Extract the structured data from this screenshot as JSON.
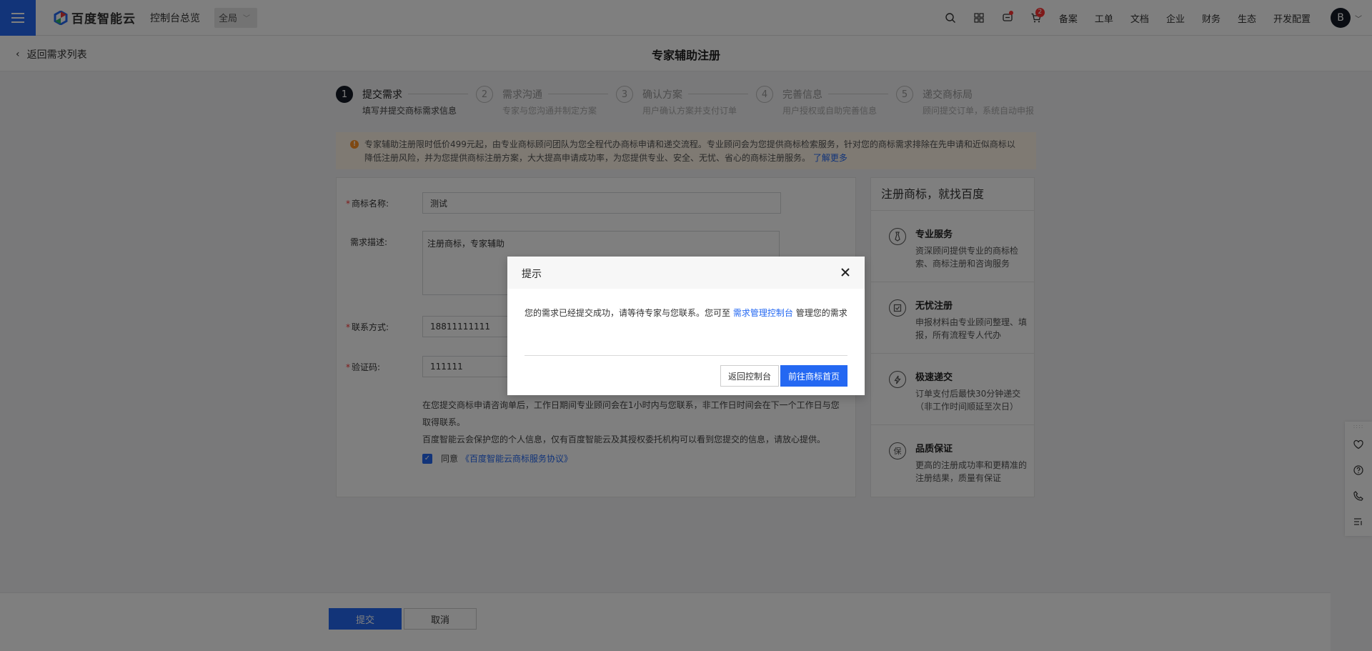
{
  "colors": {
    "brand": "#2468f2",
    "danger": "#ff3333",
    "warning": "#ff9326",
    "dark": "#151b26"
  },
  "topbar": {
    "logo_text": "百度智能云",
    "console_label": "控制台总览",
    "region_label": "全局",
    "cart_badge": "2",
    "nav_items": [
      "备案",
      "工单",
      "文档",
      "企业",
      "财务",
      "生态",
      "开发配置"
    ],
    "avatar_initial": "B",
    "icons": [
      "search-icon",
      "grid-icon",
      "message-icon",
      "cart-icon"
    ]
  },
  "subheader": {
    "back_label": "返回需求列表",
    "title": "专家辅助注册"
  },
  "steps": [
    {
      "num": "1",
      "title": "提交需求",
      "desc": "填写并提交商标需求信息",
      "active": true
    },
    {
      "num": "2",
      "title": "需求沟通",
      "desc": "专家与您沟通并制定方案",
      "active": false
    },
    {
      "num": "3",
      "title": "确认方案",
      "desc": "用户确认方案并支付订单",
      "active": false
    },
    {
      "num": "4",
      "title": "完善信息",
      "desc": "用户授权或自助完善信息",
      "active": false
    },
    {
      "num": "5",
      "title": "递交商标局",
      "desc": "顾问提交订单，系统自动申报",
      "active": false
    }
  ],
  "notice": {
    "line1": "专家辅助注册限时低价499元起，由专业商标顾问团队为您全程代办商标申请和递交流程。专业顾问会为您提供商标检索服务，针对您的商标需求排除在先申请和近似商标以",
    "line2": "降低注册风险，并为您提供商标注册方案，大大提高申请成功率，为您提供专业、安全、无忧、省心的商标注册服务。",
    "link": "了解更多"
  },
  "form": {
    "trademark_label": "商标名称:",
    "trademark_value": "测试",
    "desc_label": "需求描述:",
    "desc_value": "注册商标，专家辅助",
    "contact_label": "联系方式:",
    "contact_value": "18811111111",
    "code_label": "验证码:",
    "code_value": "111111",
    "help_line1": "在您提交商标申请咨询单后，工作日期间专业顾问会在1小时内与您联系，非工作日时间会在下一个工作日与您",
    "help_line2": "取得联系。",
    "help_line3": "百度智能云会保护您的个人信息，仅有百度智能云及其授权委托机构可以看到您提交的信息，请放心提供。",
    "agree_label": "同意",
    "agree_link": "《百度智能云商标服务协议》"
  },
  "side": {
    "title": "注册商标，就找百度",
    "items": [
      {
        "icon": "tie-icon",
        "title": "专业服务",
        "desc": "资深顾问提供专业的商标检索、商标注册和咨询服务"
      },
      {
        "icon": "checklist-icon",
        "title": "无忧注册",
        "desc": "申报材料由专业顾问整理、填报，所有流程专人代办"
      },
      {
        "icon": "lightning-icon",
        "title": "极速递交",
        "desc": "订单支付后最快30分钟递交（非工作时间顺延至次日）"
      },
      {
        "icon": "guarantee-icon",
        "title": "品质保证",
        "desc": "更高的注册成功率和更精准的注册结果，质量有保证"
      }
    ],
    "guarantee_glyph": "保"
  },
  "bottom": {
    "submit_label": "提交",
    "cancel_label": "取消"
  },
  "modal": {
    "title": "提示",
    "body_prefix": "您的需求已经提交成功，请等待专家与您联系。您可至",
    "body_link": "需求管理控制台",
    "body_suffix": "管理您的需求",
    "secondary_label": "返回控制台",
    "primary_label": "前往商标首页"
  }
}
